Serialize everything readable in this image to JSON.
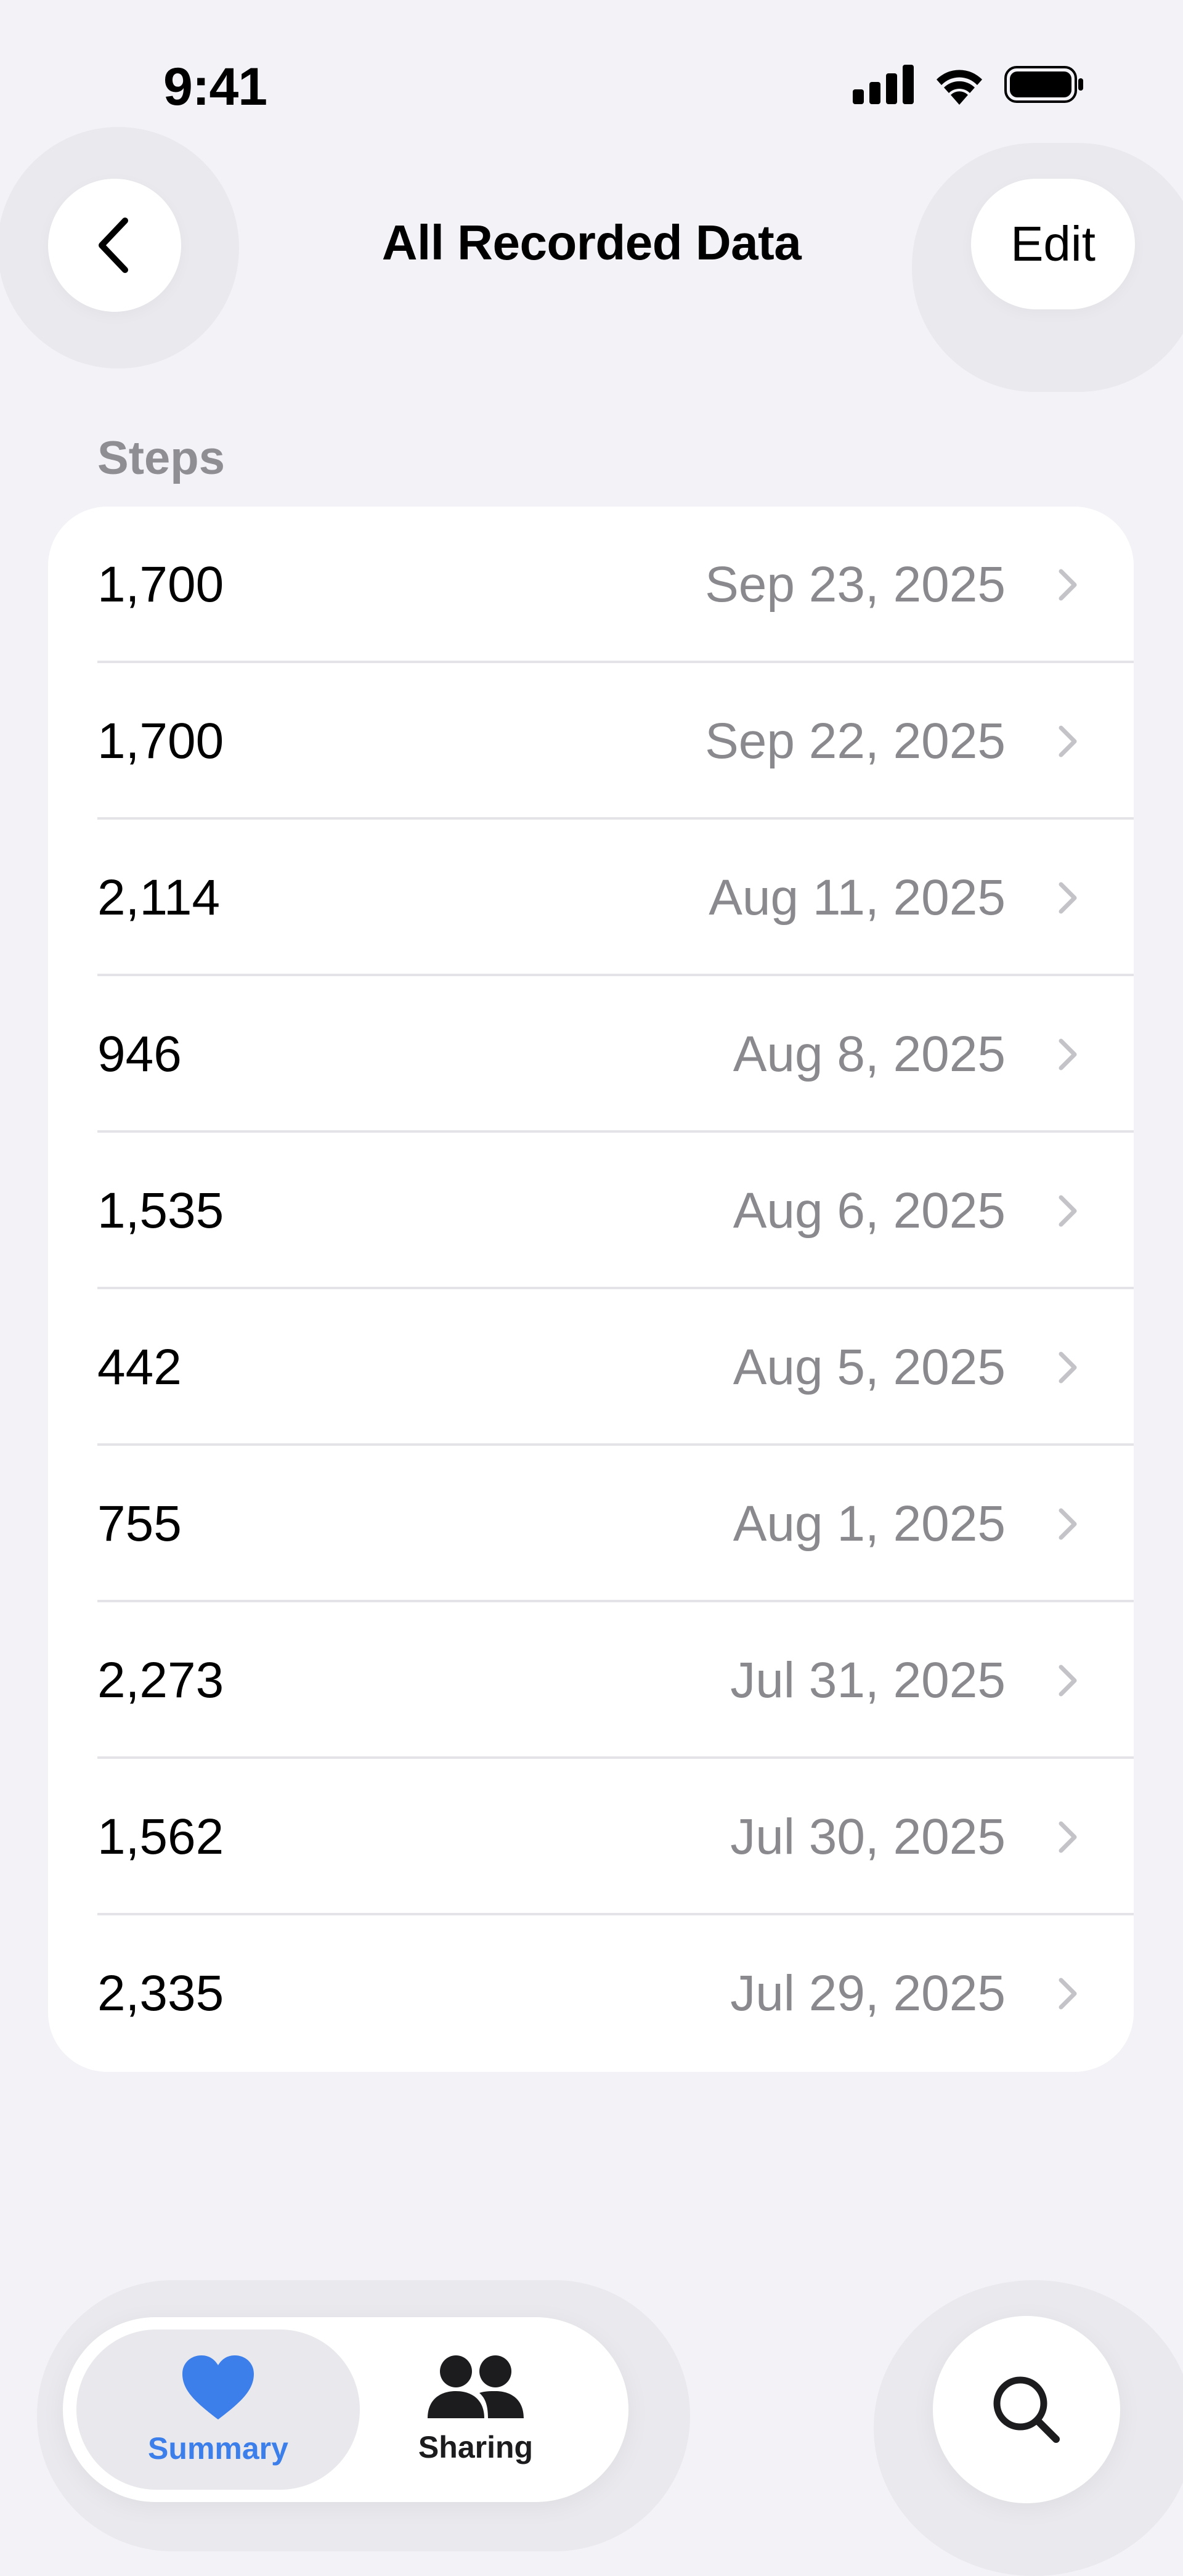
{
  "status_bar": {
    "time": "9:41"
  },
  "nav": {
    "title": "All Recorded Data",
    "back_icon": "chevron-left-icon",
    "edit_label": "Edit"
  },
  "section": {
    "title": "Steps"
  },
  "records": [
    {
      "value": "1,700",
      "date": "Sep 23, 2025"
    },
    {
      "value": "1,700",
      "date": "Sep 22, 2025"
    },
    {
      "value": "2,114",
      "date": "Aug 11, 2025"
    },
    {
      "value": "946",
      "date": "Aug 8, 2025"
    },
    {
      "value": "1,535",
      "date": "Aug 6, 2025"
    },
    {
      "value": "442",
      "date": "Aug 5, 2025"
    },
    {
      "value": "755",
      "date": "Aug 1, 2025"
    },
    {
      "value": "2,273",
      "date": "Jul 31, 2025"
    },
    {
      "value": "1,562",
      "date": "Jul 30, 2025"
    },
    {
      "value": "2,335",
      "date": "Jul 29, 2025"
    }
  ],
  "tab_bar": {
    "tabs": [
      {
        "label": "Summary",
        "icon": "heart-icon",
        "selected": true
      },
      {
        "label": "Sharing",
        "icon": "people-icon",
        "selected": false
      }
    ],
    "search_icon": "search-icon"
  },
  "colors": {
    "accent": "#3C7EEA",
    "background": "#F2F2F7",
    "secondary_text": "#8A8A8E"
  }
}
